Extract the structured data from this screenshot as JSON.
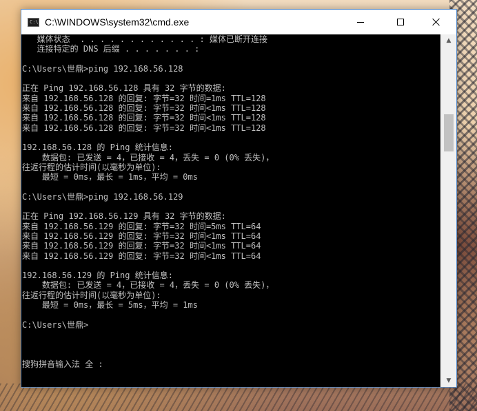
{
  "window": {
    "title": "C:\\WINDOWS\\system32\\cmd.exe",
    "icon_text": "C:\\"
  },
  "console": {
    "lines": [
      "   媒体状态  . . . . . . . . . . . . : 媒体已断开连接",
      "   连接特定的 DNS 后缀 . . . . . . . :",
      "",
      "C:\\Users\\世鼎>ping 192.168.56.128",
      "",
      "正在 Ping 192.168.56.128 具有 32 字节的数据:",
      "来自 192.168.56.128 的回复: 字节=32 时间=1ms TTL=128",
      "来自 192.168.56.128 的回复: 字节=32 时间<1ms TTL=128",
      "来自 192.168.56.128 的回复: 字节=32 时间<1ms TTL=128",
      "来自 192.168.56.128 的回复: 字节=32 时间<1ms TTL=128",
      "",
      "192.168.56.128 的 Ping 统计信息:",
      "    数据包: 已发送 = 4，已接收 = 4，丢失 = 0 (0% 丢失)，",
      "往返行程的估计时间(以毫秒为单位):",
      "    最短 = 0ms，最长 = 1ms，平均 = 0ms",
      "",
      "C:\\Users\\世鼎>ping 192.168.56.129",
      "",
      "正在 Ping 192.168.56.129 具有 32 字节的数据:",
      "来自 192.168.56.129 的回复: 字节=32 时间=5ms TTL=64",
      "来自 192.168.56.129 的回复: 字节=32 时间<1ms TTL=64",
      "来自 192.168.56.129 的回复: 字节=32 时间<1ms TTL=64",
      "来自 192.168.56.129 的回复: 字节=32 时间<1ms TTL=64",
      "",
      "192.168.56.129 的 Ping 统计信息:",
      "    数据包: 已发送 = 4，已接收 = 4，丢失 = 0 (0% 丢失)，",
      "往返行程的估计时间(以毫秒为单位):",
      "    最短 = 0ms，最长 = 5ms，平均 = 1ms",
      "",
      "C:\\Users\\世鼎>",
      "",
      "",
      "",
      "搜狗拼音输入法 全 :"
    ]
  },
  "colors": {
    "console_bg": "#000000",
    "console_fg": "#c0c0c0",
    "window_border": "#5a8ecb"
  },
  "icons": {
    "minimize": "minimize-icon",
    "maximize": "maximize-icon",
    "close": "close-icon",
    "scroll_up": "chevron-up-icon",
    "scroll_down": "chevron-down-icon"
  }
}
